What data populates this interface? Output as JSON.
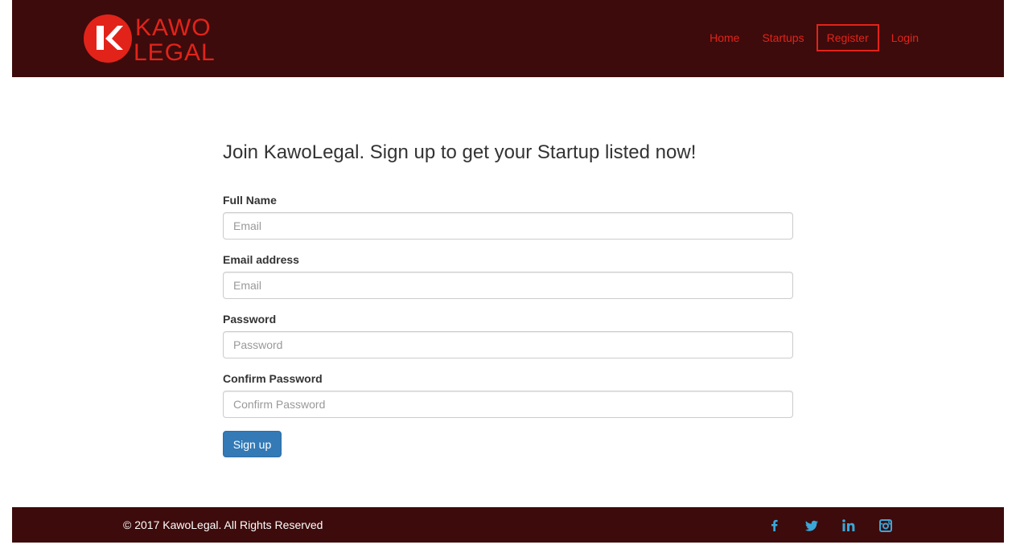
{
  "header": {
    "logo_text_line1": "KAWO",
    "logo_text_line2": "LEGAL",
    "nav": [
      {
        "label": "Home"
      },
      {
        "label": "Startups"
      },
      {
        "label": "Register",
        "active": true
      },
      {
        "label": "Login"
      }
    ]
  },
  "form": {
    "heading": "Join KawoLegal. Sign up to get your Startup listed now!",
    "fields": [
      {
        "label": "Full Name",
        "placeholder": "Email"
      },
      {
        "label": "Email address",
        "placeholder": "Email"
      },
      {
        "label": "Password",
        "placeholder": "Password"
      },
      {
        "label": "Confirm Password",
        "placeholder": "Confirm Password"
      }
    ],
    "submit_label": "Sign up"
  },
  "footer": {
    "copyright": "© 2017 KawoLegal. All Rights Reserved",
    "social_icons": [
      "facebook-icon",
      "twitter-icon",
      "linkedin-icon",
      "instagram-icon"
    ]
  },
  "colors": {
    "brand_dark": "#3d0b0b",
    "brand_red": "#e2231a",
    "primary_button": "#337ab7",
    "social_icon": "#3aa7d8"
  }
}
